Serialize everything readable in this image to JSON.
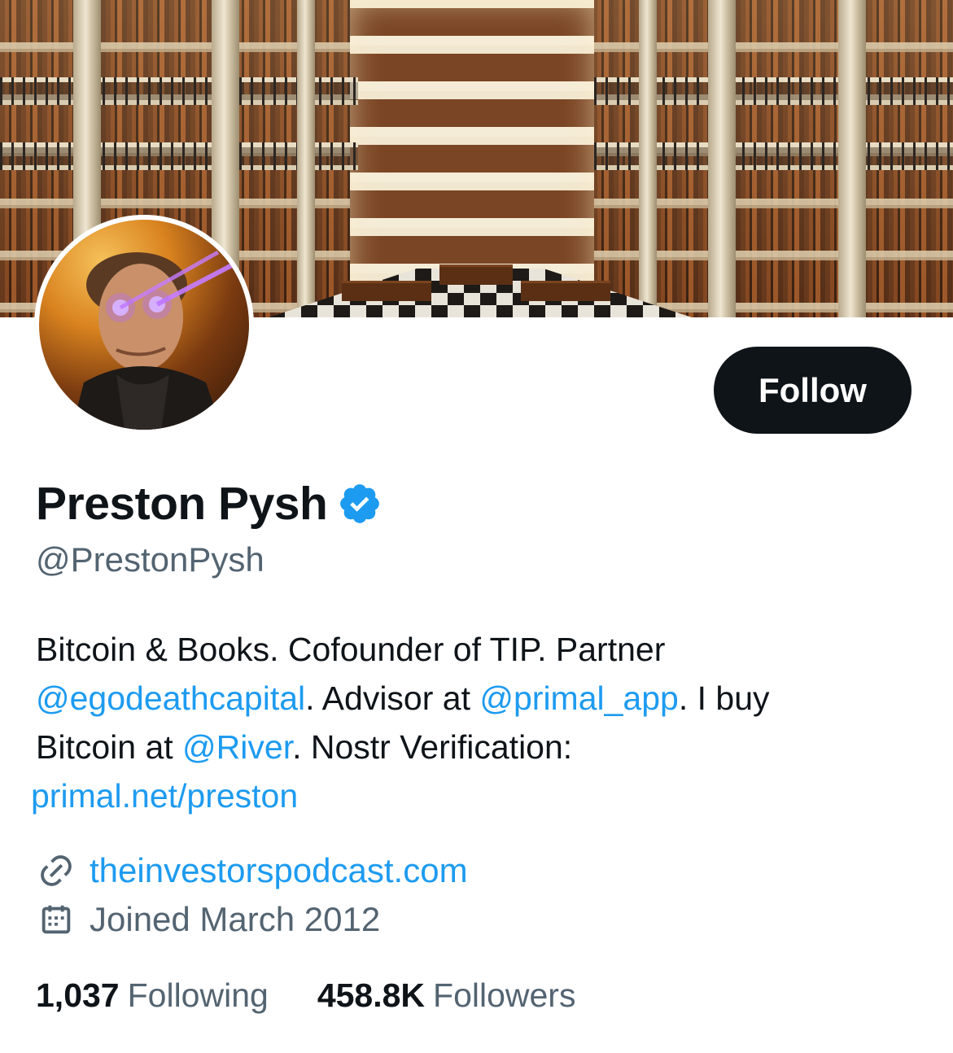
{
  "profile": {
    "display_name": "Preston Pysh",
    "handle": "@PrestonPysh",
    "follow_label": "Follow",
    "bio": {
      "text1": "Bitcoin & Books. Cofounder of TIP. Partner",
      "mention1": "@egodeathcapital",
      "text2": ". Advisor at ",
      "mention2": "@primal_app",
      "text3": ". I buy",
      "text4": "Bitcoin at ",
      "mention3": "@River",
      "text5": ". Nostr Verification:",
      "url": "primal.net/preston"
    },
    "website": "theinvestorspodcast.com",
    "joined": "Joined March 2012",
    "stats": {
      "following_count": "1,037",
      "following_label": "Following",
      "followers_count": "458.8K",
      "followers_label": "Followers"
    }
  },
  "icons": {
    "verified": "verified-badge-icon",
    "website": "link-icon",
    "joined": "calendar-icon"
  },
  "colors": {
    "accent": "#1d9bf0",
    "text_primary": "#0f1419",
    "text_secondary": "#536471",
    "button_bg": "#0f1419"
  }
}
